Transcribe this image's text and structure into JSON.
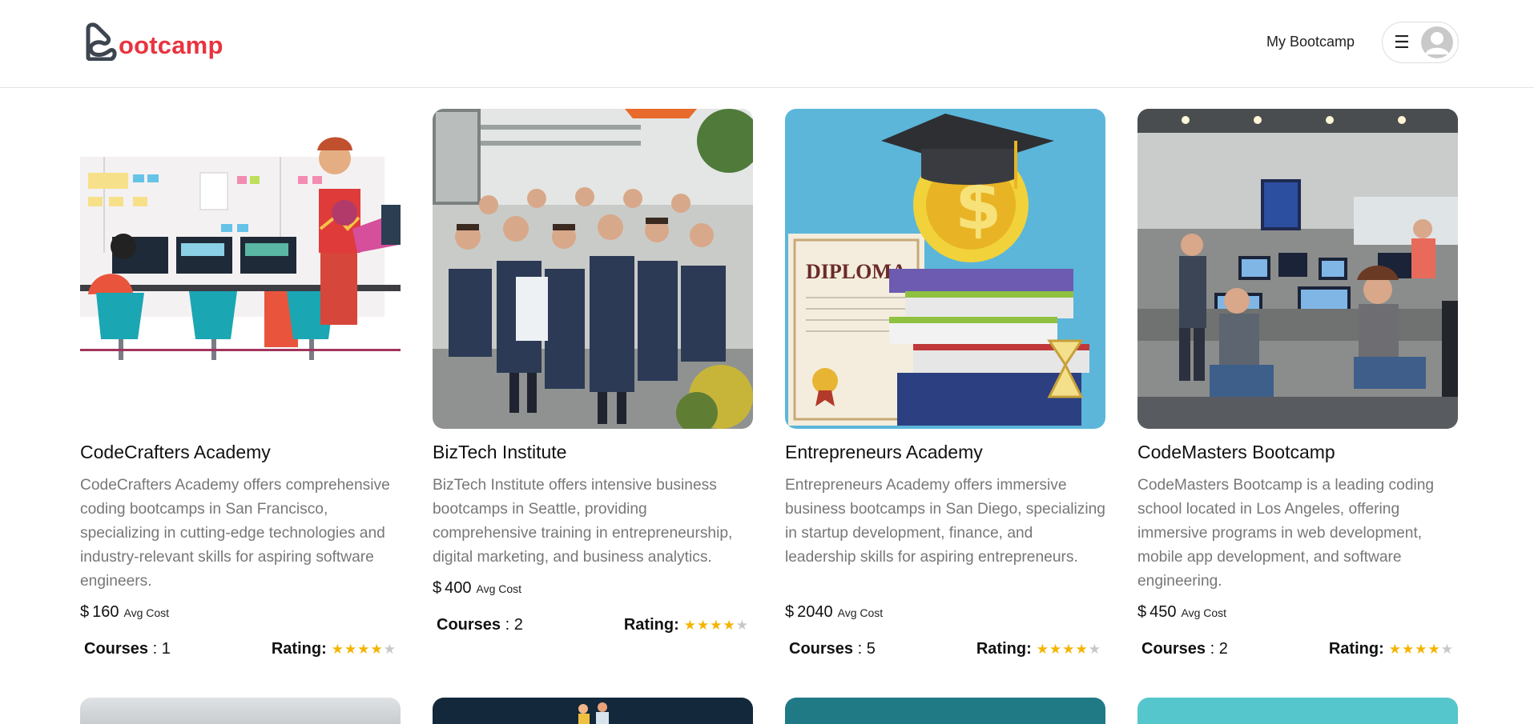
{
  "header": {
    "brand": "ootcamp",
    "nav_link": "My Bootcamp",
    "menu_icon": "hamburger-icon",
    "avatar_icon": "user-avatar-icon"
  },
  "colors": {
    "brand_red": "#e8343f",
    "brand_dark": "#3d4550",
    "star": "#f4b400",
    "star_empty": "#c8c8c8",
    "text_muted": "#777777"
  },
  "cards": [
    {
      "title": "CodeCrafters Academy",
      "description": "CodeCrafters Academy offers comprehensive coding bootcamps in San Francisco, specializing in cutting-edge technologies and industry-relevant skills for aspiring software engineers.",
      "currency": "$",
      "avg_cost": "160",
      "avg_cost_label": "Avg Cost",
      "courses_label": "Courses",
      "courses": "1",
      "rating_label": "Rating:",
      "rating": 4,
      "rating_max": 5
    },
    {
      "title": "BizTech Institute",
      "description": "BizTech Institute offers intensive business bootcamps in Seattle, providing comprehensive training in entrepreneurship, digital marketing, and business analytics.",
      "currency": "$",
      "avg_cost": "400",
      "avg_cost_label": "Avg Cost",
      "courses_label": "Courses",
      "courses": "2",
      "rating_label": "Rating:",
      "rating": 4,
      "rating_max": 5
    },
    {
      "title": "Entrepreneurs Academy",
      "description": "Entrepreneurs Academy offers immersive business bootcamps in San Diego, specializing in startup development, finance, and leadership skills for aspiring entrepreneurs.",
      "currency": "$",
      "avg_cost": "2040",
      "avg_cost_label": "Avg Cost",
      "courses_label": "Courses",
      "courses": "5",
      "rating_label": "Rating:",
      "rating": 4,
      "rating_max": 5,
      "image_text": "DIPLOMA"
    },
    {
      "title": "CodeMasters Bootcamp",
      "description": "CodeMasters Bootcamp is a leading coding school located in Los Angeles, offering immersive programs in web development, mobile app development, and software engineering.",
      "currency": "$",
      "avg_cost": "450",
      "avg_cost_label": "Avg Cost",
      "courses_label": "Courses",
      "courses": "2",
      "rating_label": "Rating:",
      "rating": 4,
      "rating_max": 5
    }
  ]
}
